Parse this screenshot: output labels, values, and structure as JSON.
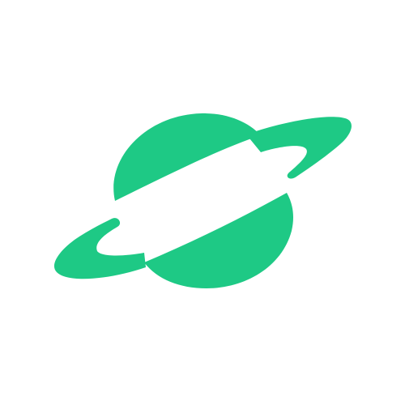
{
  "logo": {
    "icon": "planet-with-ring-icon",
    "color": "#1ec985",
    "background": "#ffffff"
  }
}
